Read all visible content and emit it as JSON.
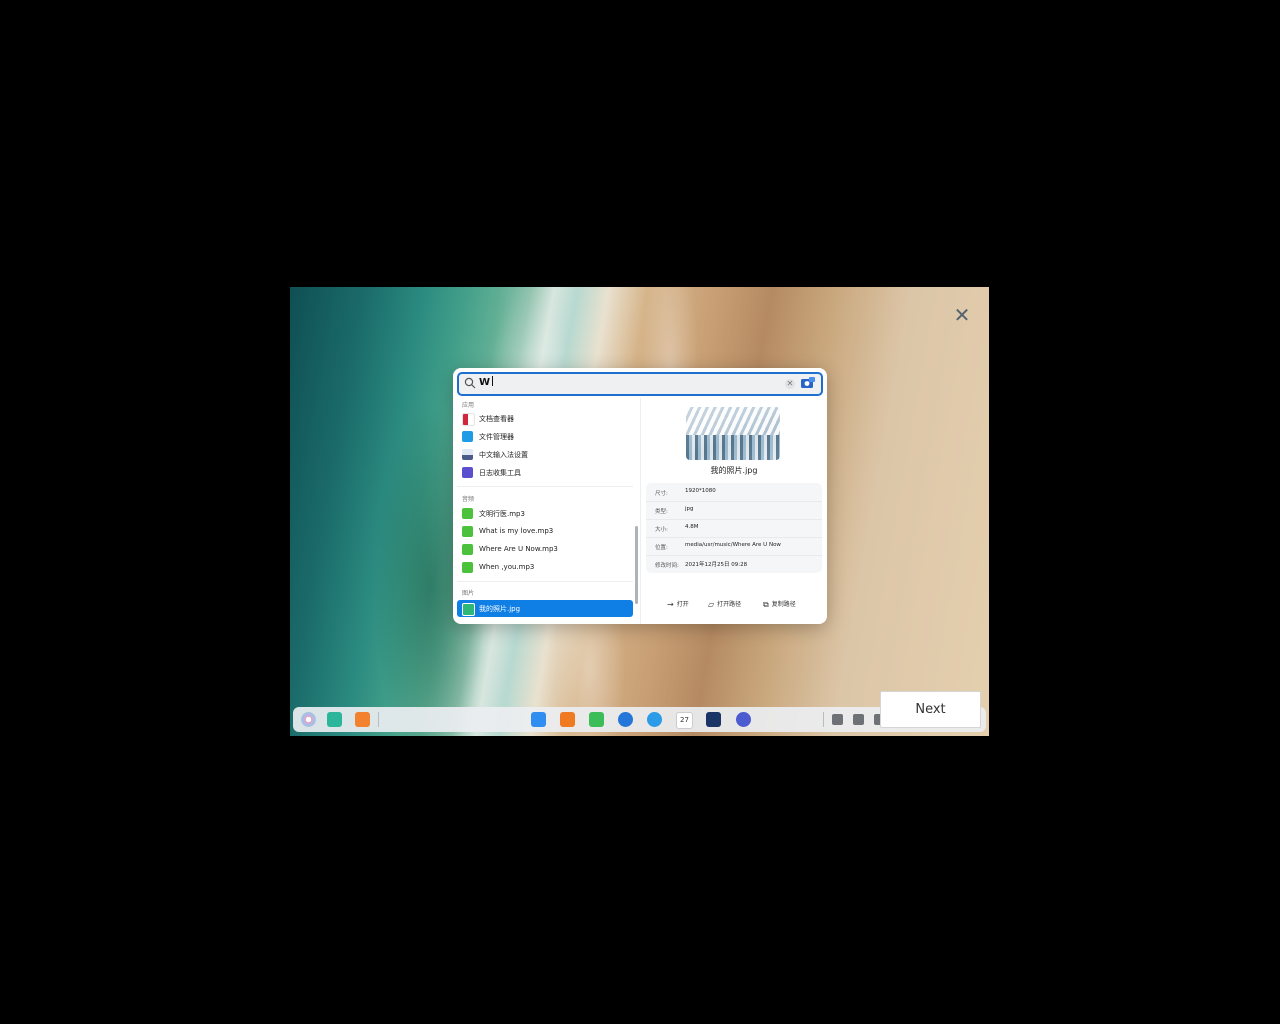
{
  "search": {
    "value": "W"
  },
  "groups": {
    "apps": "应用",
    "audio": "音频",
    "images": "图片"
  },
  "results": {
    "apps": [
      {
        "label": "文档查看器",
        "icon": "document-viewer-icon",
        "color": "#d2263a"
      },
      {
        "label": "文件管理器",
        "icon": "file-manager-icon",
        "color": "#1e9be6"
      },
      {
        "label": "中文输入法设置",
        "icon": "input-method-icon",
        "color": "#4a5a8a"
      },
      {
        "label": "日志收集工具",
        "icon": "log-collector-icon",
        "color": "#5b4fd0"
      }
    ],
    "audio": [
      {
        "label": "文明行医.mp3",
        "icon": "audio-file-icon",
        "color": "#4cc23c"
      },
      {
        "label": "What is my love.mp3",
        "icon": "audio-file-icon",
        "color": "#4cc23c"
      },
      {
        "label": "Where Are U Now.mp3",
        "icon": "audio-file-icon",
        "color": "#4cc23c"
      },
      {
        "label": "When ,you.mp3",
        "icon": "audio-file-icon",
        "color": "#4cc23c"
      }
    ],
    "images": [
      {
        "label": "我的照片.jpg",
        "icon": "image-file-icon",
        "color": "#2db87a",
        "selected": true
      }
    ]
  },
  "preview": {
    "file_name": "我的照片.jpg",
    "info": [
      {
        "key": "尺寸:",
        "value": "1920*1080"
      },
      {
        "key": "类型:",
        "value": "jpg"
      },
      {
        "key": "大小:",
        "value": "4.8M"
      },
      {
        "key": "位置:",
        "value": "media/usr/music/Where Are U Now"
      },
      {
        "key": "修改时间:",
        "value": "2021年12月25日  09:28"
      }
    ],
    "actions": {
      "open": "打开",
      "open_path": "打开路径",
      "copy_path": "复制路径"
    }
  },
  "tour": {
    "next_label": "Next"
  },
  "taskbar": {
    "left_icons": [
      {
        "name": "launcher-icon",
        "color": "#e8a6c8"
      },
      {
        "name": "multitask-view-icon",
        "color": "#2bb59a"
      },
      {
        "name": "desktop-workspace-icon",
        "color": "#f2822e"
      }
    ],
    "center_icons": [
      {
        "name": "app-store-icon",
        "color": "#2f8ef0"
      },
      {
        "name": "file-manager-dock-icon",
        "color": "#f07a22"
      },
      {
        "name": "music-icon",
        "color": "#3dbd57"
      },
      {
        "name": "security-center-icon",
        "color": "#2477d8"
      },
      {
        "name": "browser-icon",
        "color": "#2c9be8"
      },
      {
        "name": "calendar-icon",
        "color": "#ffffff"
      },
      {
        "name": "terminal-icon",
        "color": "#1b3466"
      },
      {
        "name": "settings-icon",
        "color": "#4d5bd0"
      }
    ],
    "calendar_day": "27",
    "tray_icons": [
      "volume-icon",
      "keyboard-icon",
      "network-icon",
      "notification-icon",
      "power-icon"
    ]
  }
}
